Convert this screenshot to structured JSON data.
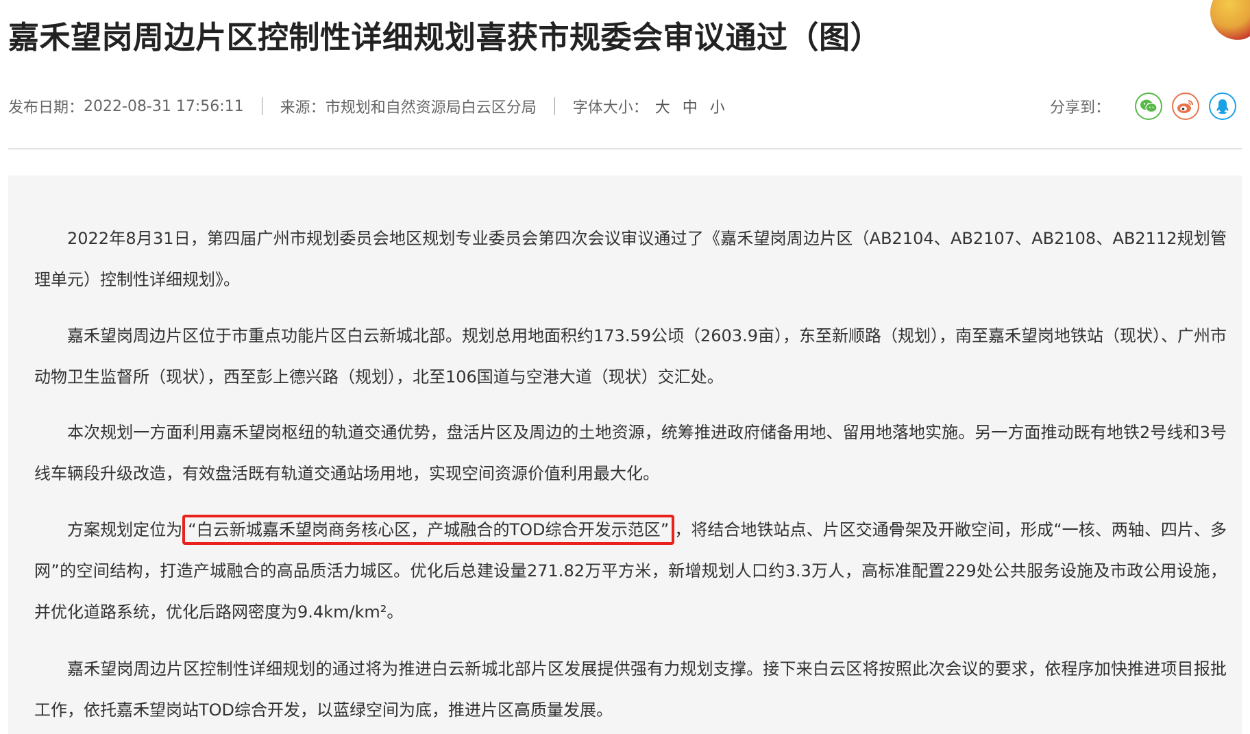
{
  "article": {
    "title": "嘉禾望岗周边片区控制性详细规划喜获市规委会审议通过（图）"
  },
  "meta": {
    "date_label": "发布日期：",
    "date_value": "2022-08-31 17:56:11",
    "source_label": "来源：",
    "source_value": "市规划和自然资源局白云区分局",
    "font_size_label": "字体大小：",
    "font_sizes": [
      "大",
      "中",
      "小"
    ],
    "share_label": "分享到："
  },
  "share_icons": [
    "wechat-icon",
    "weibo-icon",
    "qq-icon"
  ],
  "colors": {
    "wechat": "#56b948",
    "weibo": "#e8734b",
    "qq": "#1aa0e5",
    "highlight": "#e8221c"
  },
  "paragraphs": [
    "2022年8月31日，第四届广州市规划委员会地区规划专业委员会第四次会议审议通过了《嘉禾望岗周边片区（AB2104、AB2107、AB2108、AB2112规划管理单元）控制性详细规划》。",
    "嘉禾望岗周边片区位于市重点功能片区白云新城北部。规划总用地面积约173.59公顷（2603.9亩），东至新顺路（规划），南至嘉禾望岗地铁站（现状）、广州市动物卫生监督所（现状），西至彭上德兴路（规划），北至106国道与空港大道（现状）交汇处。",
    "本次规划一方面利用嘉禾望岗枢纽的轨道交通优势，盘活片区及周边的土地资源，统筹推进政府储备用地、留用地落地实施。另一方面推动既有地铁2号线和3号线车辆段升级改造，有效盘活既有轨道交通站场用地，实现空间资源价值利用最大化。",
    "嘉禾望岗周边片区控制性详细规划的通过将为推进白云新城北部片区发展提供强有力规划支撑。接下来白云区将按照此次会议的要求，依程序加快推进项目报批工作，依托嘉禾望岗站TOD综合开发，以蓝绿空间为底，推进片区高质量发展。"
  ],
  "para4": {
    "prefix": "方案规划定位为",
    "highlight": "“白云新城嘉禾望岗商务核心区，产城融合的TOD综合开发示范区”",
    "comma": "，",
    "rest": "将结合地铁站点、片区交通骨架及开敞空间，形成“一核、两轴、四片、多网”的空间结构，打造产城融合的高品质活力城区。优化后总建设量271.82万平方米，新增规划人口约3.3万人，高标准配置229处公共服务设施及市政公用设施，并优化道路系统，优化后路网密度为9.4km/km²。"
  }
}
